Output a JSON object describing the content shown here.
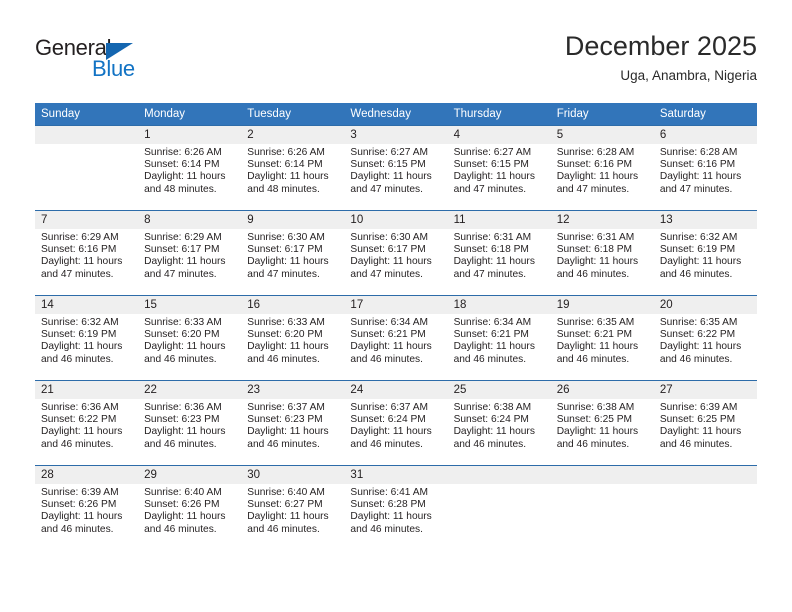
{
  "logo": {
    "word_dark": "General",
    "word_blue": "Blue",
    "triangle_color": "#1466b0",
    "blue_color": "#1273c4"
  },
  "header": {
    "month_title": "December 2025",
    "location": "Uga, Anambra, Nigeria"
  },
  "theme": {
    "header_blue": "#3275ba",
    "row_line_blue": "#2d6ca9",
    "daynum_band": "#efefef",
    "text": "#231f20"
  },
  "calendar": {
    "weekday_headers": [
      "Sunday",
      "Monday",
      "Tuesday",
      "Wednesday",
      "Thursday",
      "Friday",
      "Saturday"
    ],
    "weeks": [
      [
        {
          "day": "",
          "sunrise": "",
          "sunset": "",
          "daylight_line1": "",
          "daylight_line2": ""
        },
        {
          "day": "1",
          "sunrise": "Sunrise: 6:26 AM",
          "sunset": "Sunset: 6:14 PM",
          "daylight_line1": "Daylight: 11 hours",
          "daylight_line2": "and 48 minutes."
        },
        {
          "day": "2",
          "sunrise": "Sunrise: 6:26 AM",
          "sunset": "Sunset: 6:14 PM",
          "daylight_line1": "Daylight: 11 hours",
          "daylight_line2": "and 48 minutes."
        },
        {
          "day": "3",
          "sunrise": "Sunrise: 6:27 AM",
          "sunset": "Sunset: 6:15 PM",
          "daylight_line1": "Daylight: 11 hours",
          "daylight_line2": "and 47 minutes."
        },
        {
          "day": "4",
          "sunrise": "Sunrise: 6:27 AM",
          "sunset": "Sunset: 6:15 PM",
          "daylight_line1": "Daylight: 11 hours",
          "daylight_line2": "and 47 minutes."
        },
        {
          "day": "5",
          "sunrise": "Sunrise: 6:28 AM",
          "sunset": "Sunset: 6:16 PM",
          "daylight_line1": "Daylight: 11 hours",
          "daylight_line2": "and 47 minutes."
        },
        {
          "day": "6",
          "sunrise": "Sunrise: 6:28 AM",
          "sunset": "Sunset: 6:16 PM",
          "daylight_line1": "Daylight: 11 hours",
          "daylight_line2": "and 47 minutes."
        }
      ],
      [
        {
          "day": "7",
          "sunrise": "Sunrise: 6:29 AM",
          "sunset": "Sunset: 6:16 PM",
          "daylight_line1": "Daylight: 11 hours",
          "daylight_line2": "and 47 minutes."
        },
        {
          "day": "8",
          "sunrise": "Sunrise: 6:29 AM",
          "sunset": "Sunset: 6:17 PM",
          "daylight_line1": "Daylight: 11 hours",
          "daylight_line2": "and 47 minutes."
        },
        {
          "day": "9",
          "sunrise": "Sunrise: 6:30 AM",
          "sunset": "Sunset: 6:17 PM",
          "daylight_line1": "Daylight: 11 hours",
          "daylight_line2": "and 47 minutes."
        },
        {
          "day": "10",
          "sunrise": "Sunrise: 6:30 AM",
          "sunset": "Sunset: 6:17 PM",
          "daylight_line1": "Daylight: 11 hours",
          "daylight_line2": "and 47 minutes."
        },
        {
          "day": "11",
          "sunrise": "Sunrise: 6:31 AM",
          "sunset": "Sunset: 6:18 PM",
          "daylight_line1": "Daylight: 11 hours",
          "daylight_line2": "and 47 minutes."
        },
        {
          "day": "12",
          "sunrise": "Sunrise: 6:31 AM",
          "sunset": "Sunset: 6:18 PM",
          "daylight_line1": "Daylight: 11 hours",
          "daylight_line2": "and 46 minutes."
        },
        {
          "day": "13",
          "sunrise": "Sunrise: 6:32 AM",
          "sunset": "Sunset: 6:19 PM",
          "daylight_line1": "Daylight: 11 hours",
          "daylight_line2": "and 46 minutes."
        }
      ],
      [
        {
          "day": "14",
          "sunrise": "Sunrise: 6:32 AM",
          "sunset": "Sunset: 6:19 PM",
          "daylight_line1": "Daylight: 11 hours",
          "daylight_line2": "and 46 minutes."
        },
        {
          "day": "15",
          "sunrise": "Sunrise: 6:33 AM",
          "sunset": "Sunset: 6:20 PM",
          "daylight_line1": "Daylight: 11 hours",
          "daylight_line2": "and 46 minutes."
        },
        {
          "day": "16",
          "sunrise": "Sunrise: 6:33 AM",
          "sunset": "Sunset: 6:20 PM",
          "daylight_line1": "Daylight: 11 hours",
          "daylight_line2": "and 46 minutes."
        },
        {
          "day": "17",
          "sunrise": "Sunrise: 6:34 AM",
          "sunset": "Sunset: 6:21 PM",
          "daylight_line1": "Daylight: 11 hours",
          "daylight_line2": "and 46 minutes."
        },
        {
          "day": "18",
          "sunrise": "Sunrise: 6:34 AM",
          "sunset": "Sunset: 6:21 PM",
          "daylight_line1": "Daylight: 11 hours",
          "daylight_line2": "and 46 minutes."
        },
        {
          "day": "19",
          "sunrise": "Sunrise: 6:35 AM",
          "sunset": "Sunset: 6:21 PM",
          "daylight_line1": "Daylight: 11 hours",
          "daylight_line2": "and 46 minutes."
        },
        {
          "day": "20",
          "sunrise": "Sunrise: 6:35 AM",
          "sunset": "Sunset: 6:22 PM",
          "daylight_line1": "Daylight: 11 hours",
          "daylight_line2": "and 46 minutes."
        }
      ],
      [
        {
          "day": "21",
          "sunrise": "Sunrise: 6:36 AM",
          "sunset": "Sunset: 6:22 PM",
          "daylight_line1": "Daylight: 11 hours",
          "daylight_line2": "and 46 minutes."
        },
        {
          "day": "22",
          "sunrise": "Sunrise: 6:36 AM",
          "sunset": "Sunset: 6:23 PM",
          "daylight_line1": "Daylight: 11 hours",
          "daylight_line2": "and 46 minutes."
        },
        {
          "day": "23",
          "sunrise": "Sunrise: 6:37 AM",
          "sunset": "Sunset: 6:23 PM",
          "daylight_line1": "Daylight: 11 hours",
          "daylight_line2": "and 46 minutes."
        },
        {
          "day": "24",
          "sunrise": "Sunrise: 6:37 AM",
          "sunset": "Sunset: 6:24 PM",
          "daylight_line1": "Daylight: 11 hours",
          "daylight_line2": "and 46 minutes."
        },
        {
          "day": "25",
          "sunrise": "Sunrise: 6:38 AM",
          "sunset": "Sunset: 6:24 PM",
          "daylight_line1": "Daylight: 11 hours",
          "daylight_line2": "and 46 minutes."
        },
        {
          "day": "26",
          "sunrise": "Sunrise: 6:38 AM",
          "sunset": "Sunset: 6:25 PM",
          "daylight_line1": "Daylight: 11 hours",
          "daylight_line2": "and 46 minutes."
        },
        {
          "day": "27",
          "sunrise": "Sunrise: 6:39 AM",
          "sunset": "Sunset: 6:25 PM",
          "daylight_line1": "Daylight: 11 hours",
          "daylight_line2": "and 46 minutes."
        }
      ],
      [
        {
          "day": "28",
          "sunrise": "Sunrise: 6:39 AM",
          "sunset": "Sunset: 6:26 PM",
          "daylight_line1": "Daylight: 11 hours",
          "daylight_line2": "and 46 minutes."
        },
        {
          "day": "29",
          "sunrise": "Sunrise: 6:40 AM",
          "sunset": "Sunset: 6:26 PM",
          "daylight_line1": "Daylight: 11 hours",
          "daylight_line2": "and 46 minutes."
        },
        {
          "day": "30",
          "sunrise": "Sunrise: 6:40 AM",
          "sunset": "Sunset: 6:27 PM",
          "daylight_line1": "Daylight: 11 hours",
          "daylight_line2": "and 46 minutes."
        },
        {
          "day": "31",
          "sunrise": "Sunrise: 6:41 AM",
          "sunset": "Sunset: 6:28 PM",
          "daylight_line1": "Daylight: 11 hours",
          "daylight_line2": "and 46 minutes."
        },
        {
          "day": "",
          "sunrise": "",
          "sunset": "",
          "daylight_line1": "",
          "daylight_line2": ""
        },
        {
          "day": "",
          "sunrise": "",
          "sunset": "",
          "daylight_line1": "",
          "daylight_line2": ""
        },
        {
          "day": "",
          "sunrise": "",
          "sunset": "",
          "daylight_line1": "",
          "daylight_line2": ""
        }
      ]
    ]
  }
}
